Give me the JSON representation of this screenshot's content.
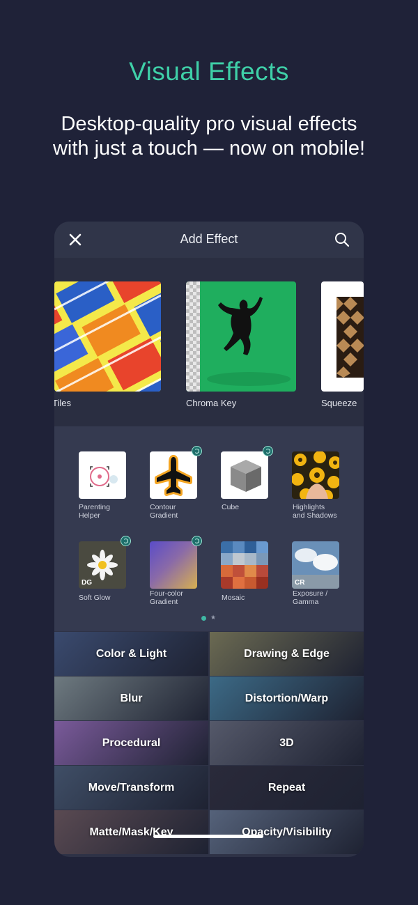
{
  "hero": {
    "title": "Visual Effects",
    "subtitle_line1": "Desktop-quality pro visual effects",
    "subtitle_line2": "with just a touch — now on mobile!"
  },
  "topbar": {
    "title": "Add Effect",
    "close_icon": "close-icon",
    "search_icon": "search-icon"
  },
  "featured": [
    {
      "label": "Tiles"
    },
    {
      "label": "Chroma Key"
    },
    {
      "label": "Squeeze"
    }
  ],
  "effects": [
    {
      "label": "Parenting\nHelper",
      "badge": false,
      "tag": ""
    },
    {
      "label": "Contour\nGradient",
      "badge": true,
      "tag": ""
    },
    {
      "label": "Cube",
      "badge": true,
      "tag": ""
    },
    {
      "label": "Highlights\nand Shadows",
      "badge": false,
      "tag": ""
    },
    {
      "label": "Soft Glow",
      "badge": true,
      "tag": "DG"
    },
    {
      "label": "Four-color\nGradient",
      "badge": true,
      "tag": ""
    },
    {
      "label": "Mosaic",
      "badge": false,
      "tag": ""
    },
    {
      "label": "Exposure /\nGamma",
      "badge": false,
      "tag": "CR"
    }
  ],
  "pagination": {
    "pages": 2,
    "current": 1
  },
  "categories": [
    {
      "label": "Color & Light",
      "color": "#3a4a6e"
    },
    {
      "label": "Drawing & Edge",
      "color": "#6b6a52"
    },
    {
      "label": "Blur",
      "color": "#6e7a80"
    },
    {
      "label": "Distortion/Warp",
      "color": "#3c6a86"
    },
    {
      "label": "Procedural",
      "color": "#7a5a9a"
    },
    {
      "label": "3D",
      "color": "#55596a"
    },
    {
      "label": "Move/Transform",
      "color": "#3f4e66"
    },
    {
      "label": "Repeat",
      "color": "#2a2a3a"
    },
    {
      "label": "Matte/Mask/Key",
      "color": "#5a4a52"
    },
    {
      "label": "Opacity/Visibility",
      "color": "#55627a"
    }
  ],
  "colors": {
    "background": "#1f2238",
    "accent": "#3fd0a8",
    "panel": "#2e3246"
  }
}
